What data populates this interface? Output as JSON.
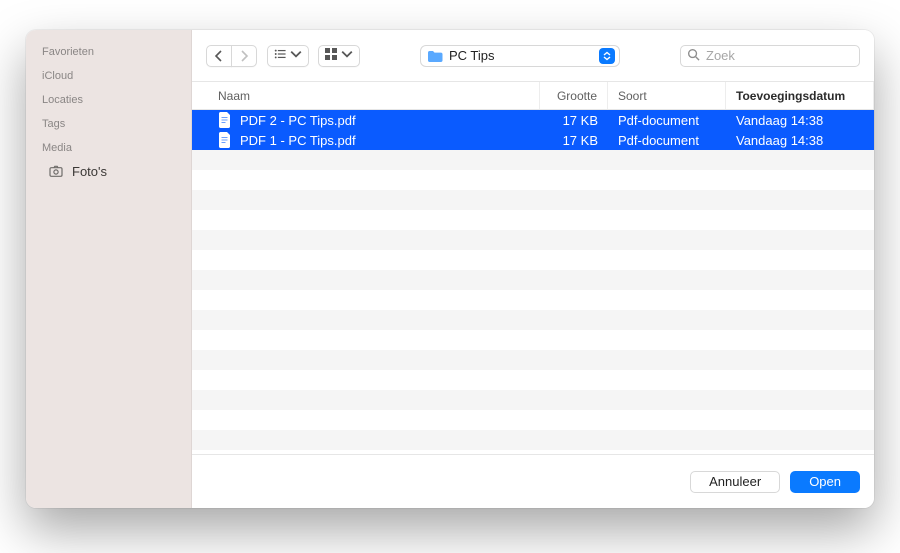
{
  "sidebar": {
    "sections": [
      {
        "label": "Favorieten"
      },
      {
        "label": "iCloud"
      },
      {
        "label": "Locaties"
      },
      {
        "label": "Tags"
      },
      {
        "label": "Media"
      }
    ],
    "media_item": {
      "label": "Foto's"
    }
  },
  "toolbar": {
    "path_folder": "PC Tips",
    "search_placeholder": "Zoek"
  },
  "columns": {
    "name": "Naam",
    "size": "Grootte",
    "kind": "Soort",
    "date": "Toevoegingsdatum"
  },
  "files": [
    {
      "name": "PDF 2 - PC Tips.pdf",
      "size": "17 KB",
      "kind": "Pdf-document",
      "date": "Vandaag 14:38"
    },
    {
      "name": "PDF 1 - PC Tips.pdf",
      "size": "17 KB",
      "kind": "Pdf-document",
      "date": "Vandaag 14:38"
    }
  ],
  "footer": {
    "cancel": "Annuleer",
    "open": "Open"
  }
}
